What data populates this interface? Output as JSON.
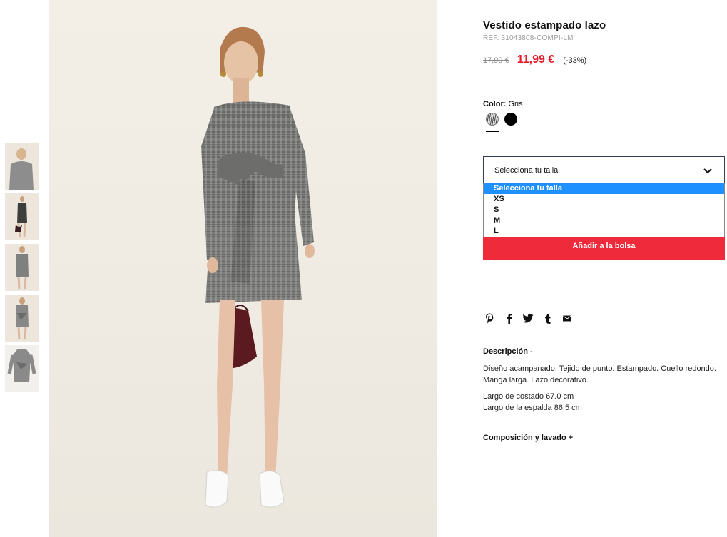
{
  "product": {
    "title": "Vestido estampado lazo",
    "ref": "REF. 31043808-COMPI-LM",
    "old_price": "17,99 €",
    "new_price": "11,99 €",
    "discount": "(-33%)"
  },
  "color": {
    "label": "Color:",
    "value": "Gris",
    "swatches": [
      {
        "name": "Gris",
        "icon": "grey-check-pattern"
      },
      {
        "name": "Negro",
        "color": "#000000"
      }
    ]
  },
  "size": {
    "placeholder": "Selecciona tu talla",
    "options": [
      "Selecciona tu talla",
      "XS",
      "S",
      "M",
      "L"
    ]
  },
  "actions": {
    "add_to_bag": "Añadir a la bolsa"
  },
  "share": [
    "pinterest-icon",
    "facebook-icon",
    "twitter-icon",
    "tumblr-icon",
    "email-icon"
  ],
  "description": {
    "title": "Descripción -",
    "text": "Diseño acampanado. Tejido de punto. Estampado. Cuello redondo. Manga larga. Lazo decorativo.",
    "measure_1": "Largo de costado 67.0 cm",
    "measure_2": "Largo de la espalda 86.5 cm"
  },
  "composition": {
    "title": "Composición y lavado +"
  },
  "colors": {
    "price_red": "#e51e2f",
    "button_red": "#ee2a3b",
    "select_highlight": "#1e90ff"
  }
}
